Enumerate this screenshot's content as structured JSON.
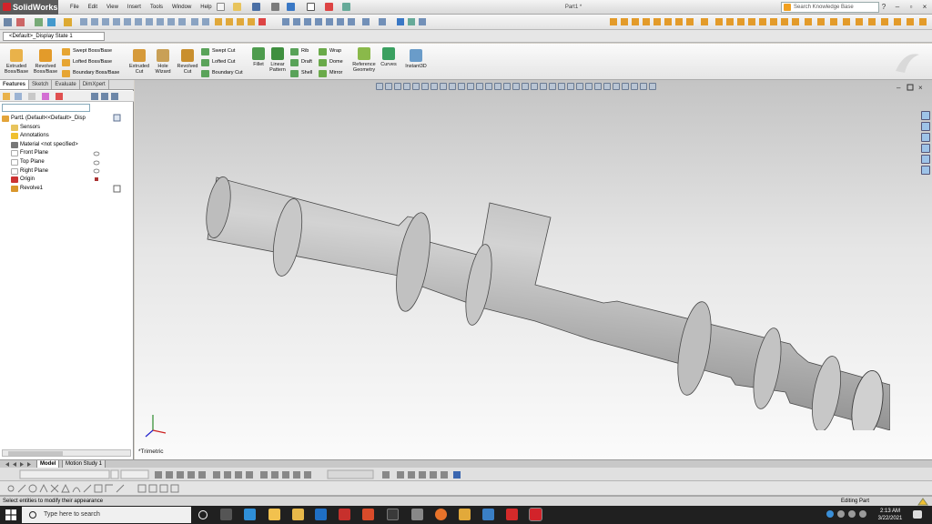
{
  "app": {
    "name": "SolidWorks",
    "document_title": "Part1 *"
  },
  "menu": [
    "File",
    "Edit",
    "View",
    "Insert",
    "Tools",
    "Window",
    "Help"
  ],
  "search": {
    "placeholder": "Search Knowledge Base"
  },
  "configuration": {
    "selected": "<Default>_Display State 1"
  },
  "command_manager": {
    "features": {
      "extruded_boss": "Extruded Boss/Base",
      "revolved_boss": "Revolved Boss/Base",
      "swept_boss": "Swept Boss/Base",
      "lofted_boss": "Lofted Boss/Base",
      "boundary_boss": "Boundary Boss/Base",
      "extruded_cut": "Extruded Cut",
      "hole_wizard": "Hole Wizard",
      "revolved_cut": "Revolved Cut",
      "swept_cut": "Swept Cut",
      "lofted_cut": "Lofted Cut",
      "boundary_cut": "Boundary Cut",
      "fillet": "Fillet",
      "linear_pattern": "Linear Pattern",
      "rib": "Rib",
      "draft": "Draft",
      "shell": "Shell",
      "wrap": "Wrap",
      "dome": "Dome",
      "mirror": "Mirror",
      "reference_geometry": "Reference Geometry",
      "curves": "Curves",
      "instant3d": "Instant3D"
    }
  },
  "panel_tabs": [
    "Features",
    "Sketch",
    "Evaluate",
    "DimXpert"
  ],
  "feature_tree": [
    {
      "label": "Part1  (Default<<Default>_Disp",
      "icon": "part-icon"
    },
    {
      "label": "Sensors",
      "icon": "sensors-icon"
    },
    {
      "label": "Annotations",
      "icon": "annotations-icon"
    },
    {
      "label": "Material <not specified>",
      "icon": "material-icon"
    },
    {
      "label": "Front Plane",
      "icon": "plane-icon"
    },
    {
      "label": "Top Plane",
      "icon": "plane-icon"
    },
    {
      "label": "Right Plane",
      "icon": "plane-icon"
    },
    {
      "label": "Origin",
      "icon": "origin-icon"
    },
    {
      "label": "Revolve1",
      "icon": "revolve-icon"
    }
  ],
  "viewport": {
    "view_label": "*Trimetric",
    "background_top": "#c4c4c4",
    "background_bottom": "#fbfbfb"
  },
  "bottom_tabs": [
    "Model",
    "Motion Study 1"
  ],
  "status": {
    "message": "Select entities to modify their appearance",
    "mode": "Editing Part"
  },
  "taskbar": {
    "search_placeholder": "Type here to search",
    "time": "2:13 AM",
    "date": "3/22/2021"
  },
  "colors": {
    "accent": "#d2232a",
    "taskbar": "#202020"
  }
}
